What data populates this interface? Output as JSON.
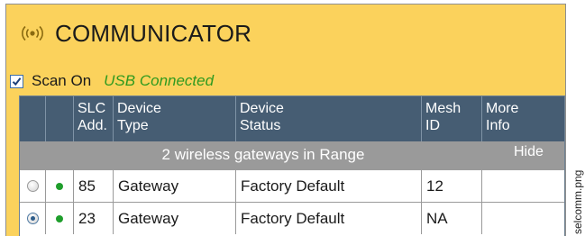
{
  "panel": {
    "title": "COMMUNICATOR",
    "icon": "wireless-signal-icon",
    "accent_color": "#fbd25c"
  },
  "scan": {
    "checked": true,
    "label": "Scan On",
    "status": "USB Connected",
    "status_color": "#2f9a1f"
  },
  "grid": {
    "columns": [
      {
        "line1": "",
        "line2": ""
      },
      {
        "line1": "",
        "line2": ""
      },
      {
        "line1": "SLC",
        "line2": "Add."
      },
      {
        "line1": "Device",
        "line2": "Type"
      },
      {
        "line1": "Device",
        "line2": "Status"
      },
      {
        "line1": "Mesh",
        "line2": "ID"
      },
      {
        "line1": "More",
        "line2": "Info"
      }
    ],
    "group_text": "2 wireless gateways in Range",
    "hide_label": "Hide",
    "rows": [
      {
        "selected": false,
        "online": true,
        "slc": "85",
        "type": "Gateway",
        "status": "Factory Default",
        "mesh_id": "12",
        "info": ""
      },
      {
        "selected": true,
        "online": true,
        "slc": "23",
        "type": "Gateway",
        "status": "Factory Default",
        "mesh_id": "NA",
        "info": ""
      }
    ]
  },
  "side_label": "selcomm.png"
}
